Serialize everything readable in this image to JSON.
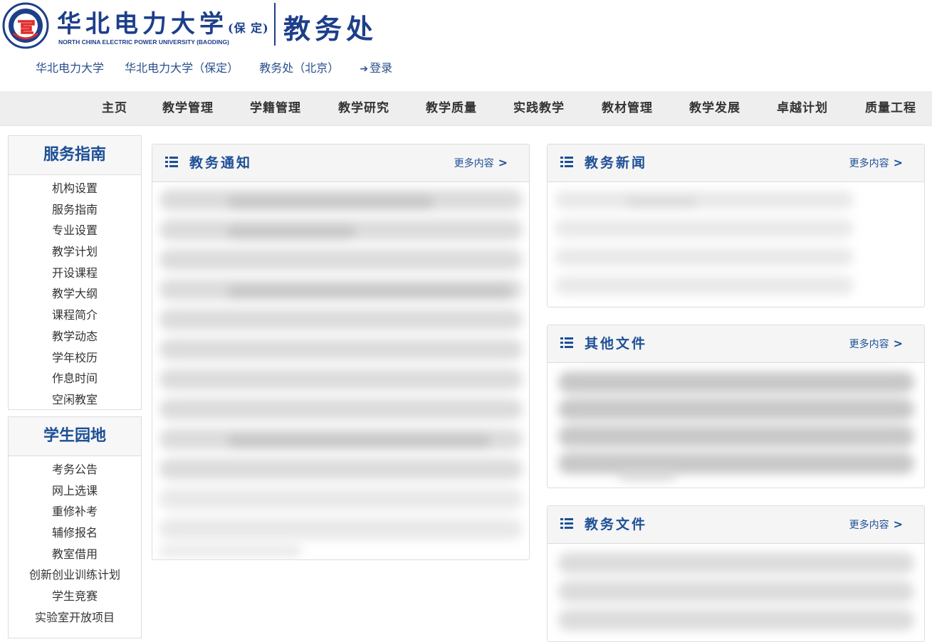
{
  "header": {
    "school_cn": "华北电力大学",
    "school_campus": "(保 定)",
    "school_en": "NORTH CHINA ELECTRIC POWER UNIVERSITY (BAODING)",
    "office": "教务处"
  },
  "top_links": [
    {
      "label": "华北电力大学"
    },
    {
      "label": "华北电力大学（保定）"
    },
    {
      "label": "教务处（北京）"
    },
    {
      "label": "登录"
    }
  ],
  "nav": [
    {
      "label": "主页"
    },
    {
      "label": "教学管理"
    },
    {
      "label": "学籍管理"
    },
    {
      "label": "教学研究"
    },
    {
      "label": "教学质量"
    },
    {
      "label": "实践教学"
    },
    {
      "label": "教材管理"
    },
    {
      "label": "教学发展"
    },
    {
      "label": "卓越计划"
    },
    {
      "label": "质量工程"
    }
  ],
  "sidebar": {
    "services": {
      "title": "服务指南",
      "items": [
        "机构设置",
        "服务指南",
        "专业设置",
        "教学计划",
        "开设课程",
        "教学大纲",
        "课程简介",
        "教学动态",
        "学年校历",
        "作息时间",
        "空闲教室"
      ]
    },
    "students": {
      "title": "学生园地",
      "items": [
        "考务公告",
        "网上选课",
        "重修补考",
        "辅修报名",
        "教室借用",
        "创新创业训练计划",
        "学生竞赛",
        "实验室开放项目"
      ]
    }
  },
  "panels": {
    "notices": {
      "title": "教务通知",
      "more": "更多内容"
    },
    "news": {
      "title": "教务新闻",
      "more": "更多内容"
    },
    "other_files": {
      "title": "其他文件",
      "more": "更多内容"
    },
    "academic_files": {
      "title": "教务文件",
      "more": "更多内容"
    }
  },
  "colors": {
    "brand": "#1d3f8a",
    "accent": "#1d4f96",
    "nav_bg": "#eeeeee"
  }
}
